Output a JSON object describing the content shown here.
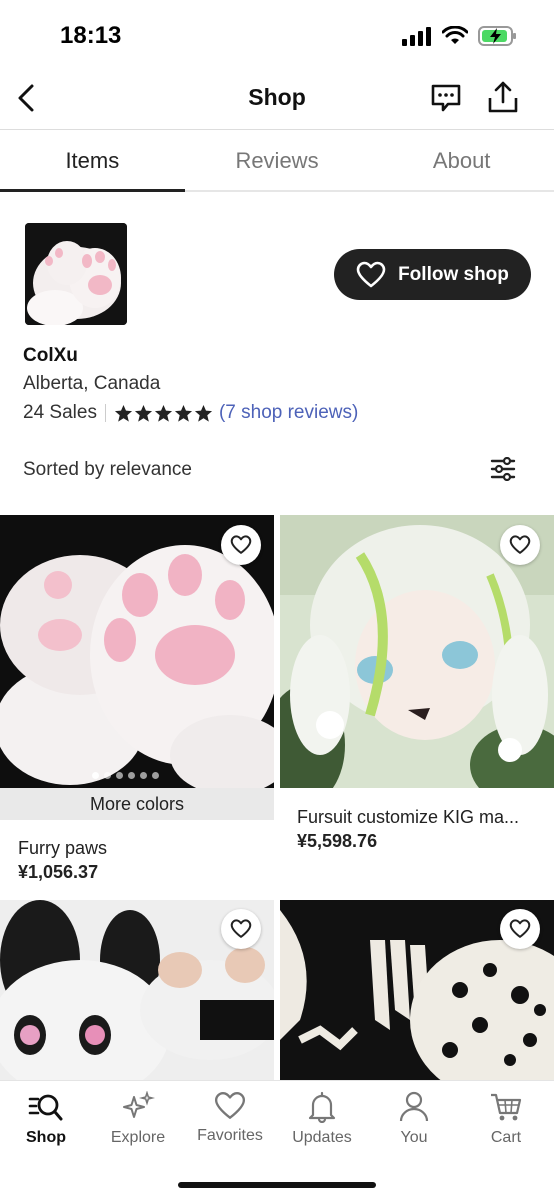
{
  "status_bar": {
    "time": "18:13"
  },
  "header": {
    "title": "Shop",
    "icons": [
      "back-icon",
      "message-icon",
      "share-icon"
    ]
  },
  "tabs": [
    {
      "label": "Items",
      "active": true
    },
    {
      "label": "Reviews",
      "active": false
    },
    {
      "label": "About",
      "active": false
    }
  ],
  "shop": {
    "name": "ColXu",
    "location": "Alberta, Canada",
    "sales": "24 Sales",
    "rating_stars": 5,
    "reviews_link": "(7 shop reviews)",
    "follow_label": "Follow shop"
  },
  "sort": {
    "label": "Sorted by relevance"
  },
  "listings": [
    {
      "title": "Furry paws",
      "price": "¥1,056.37",
      "badge": "More colors",
      "image": "white furry paw gloves"
    },
    {
      "title": "Fursuit customize KIG ma...",
      "price": "¥5,598.76",
      "image": "white and green haired kig mask"
    },
    {
      "title": "",
      "price": "",
      "image": "black and white fursuit head"
    },
    {
      "title": "",
      "price": "",
      "image": "white mask blanks with spots"
    }
  ],
  "bottom_nav": [
    {
      "label": "Shop",
      "icon": "shop-search-icon",
      "active": true
    },
    {
      "label": "Explore",
      "icon": "sparkle-icon",
      "active": false
    },
    {
      "label": "Favorites",
      "icon": "heart-icon",
      "active": false
    },
    {
      "label": "Updates",
      "icon": "bell-icon",
      "active": false
    },
    {
      "label": "You",
      "icon": "person-icon",
      "active": false
    },
    {
      "label": "Cart",
      "icon": "cart-icon",
      "active": false
    }
  ],
  "colors": {
    "accent_link": "#4d62b8",
    "button_dark": "#222222"
  }
}
